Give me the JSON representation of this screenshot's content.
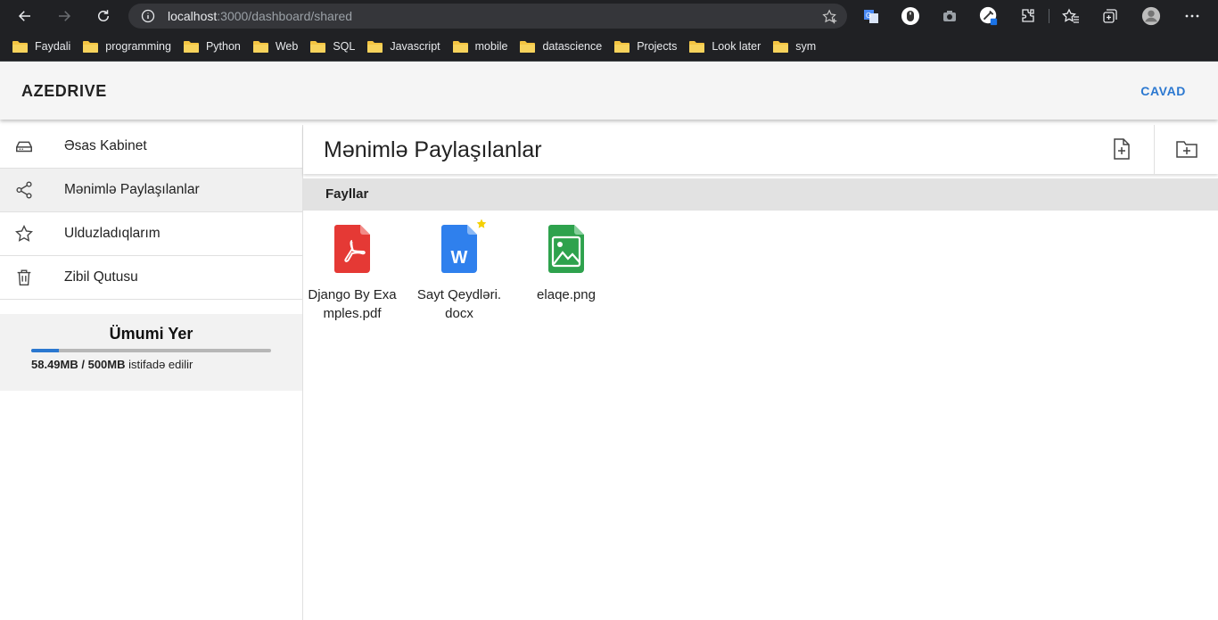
{
  "browser": {
    "url_host": "localhost",
    "url_rest": ":3000/dashboard/shared",
    "bookmarks": [
      "Faydali",
      "programming",
      "Python",
      "Web",
      "SQL",
      "Javascript",
      "mobile",
      "datascience",
      "Projects",
      "Look later",
      "sym"
    ]
  },
  "app": {
    "brand": "AZEDRIVE",
    "logout": "CAVAD"
  },
  "sidebar": {
    "items": [
      {
        "label": "Əsas Kabinet",
        "icon": "drive-icon"
      },
      {
        "label": "Mənimlə Paylaşılanlar",
        "icon": "share-icon",
        "active": true
      },
      {
        "label": "Ulduzladıqlarım",
        "icon": "star-icon"
      },
      {
        "label": "Zibil Qutusu",
        "icon": "trash-icon"
      }
    ],
    "storage": {
      "title": "Ümumi Yer",
      "used": "58.49MB / 500MB",
      "suffix": " istifadə edilir",
      "fraction": 0.117
    }
  },
  "main": {
    "title": "Mənimlə Paylaşılanlar",
    "section": "Fayllar",
    "files": [
      {
        "name": "Django By Examples.pdf",
        "type": "pdf",
        "starred": false
      },
      {
        "name": "Sayt Qeydləri.docx",
        "type": "docx",
        "starred": true
      },
      {
        "name": "elaqe.png",
        "type": "image",
        "starred": false
      }
    ]
  },
  "colors": {
    "accent": "#2b78d0",
    "pdf": "#e53935",
    "doc": "#2f80ed",
    "image": "#2ea24d",
    "star": "#f5d000"
  }
}
